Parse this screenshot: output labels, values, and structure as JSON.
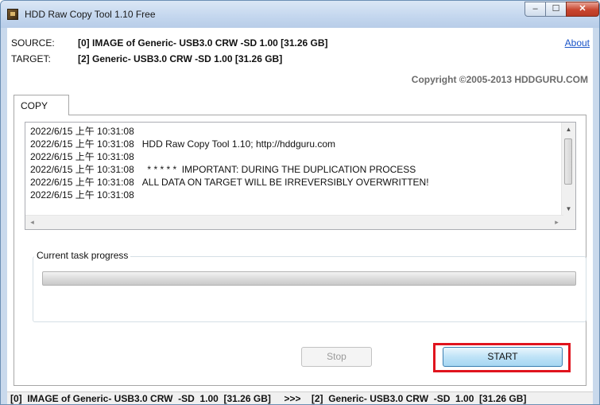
{
  "window": {
    "title": "HDD Raw Copy Tool 1.10   Free",
    "controls": {
      "minimize": "–",
      "maximize": "☐",
      "close": "✕"
    }
  },
  "info": {
    "source_label": "SOURCE:",
    "source_value": "[0]  IMAGE of Generic- USB3.0 CRW  -SD  1.00  [31.26 GB]",
    "target_label": "TARGET:",
    "target_value": "[2]  Generic- USB3.0 CRW  -SD  1.00  [31.26 GB]",
    "about_link": "About",
    "copyright": "Copyright ©2005-2013 HDDGURU.COM"
  },
  "tabs": [
    {
      "label": "COPY",
      "active": true
    }
  ],
  "log": {
    "lines": [
      "2022/6/15 上午 10:31:08",
      "2022/6/15 上午 10:31:08   HDD Raw Copy Tool 1.10; http://hddguru.com",
      "2022/6/15 上午 10:31:08",
      "2022/6/15 上午 10:31:08     * * * * *  IMPORTANT: DURING THE DUPLICATION PROCESS",
      "2022/6/15 上午 10:31:08   ALL DATA ON TARGET WILL BE IRREVERSIBLY OVERWRITTEN!",
      "2022/6/15 上午 10:31:08"
    ],
    "scroll_up_icon": "▲",
    "scroll_down_icon": "▼",
    "scroll_left_icon": "◂",
    "scroll_right_icon": "▸"
  },
  "progress": {
    "group_label": "Current task progress",
    "value_fraction": 0.0
  },
  "buttons": {
    "stop": {
      "label": "Stop",
      "enabled": false
    },
    "start": {
      "label": "START",
      "enabled": true,
      "highlight_color": "#e0141e"
    }
  },
  "statusbar": {
    "text": "[0]  IMAGE of Generic- USB3.0 CRW  -SD  1.00  [31.26 GB]     >>>    [2]  Generic- USB3.0 CRW  -SD  1.00  [31.26 GB]"
  }
}
